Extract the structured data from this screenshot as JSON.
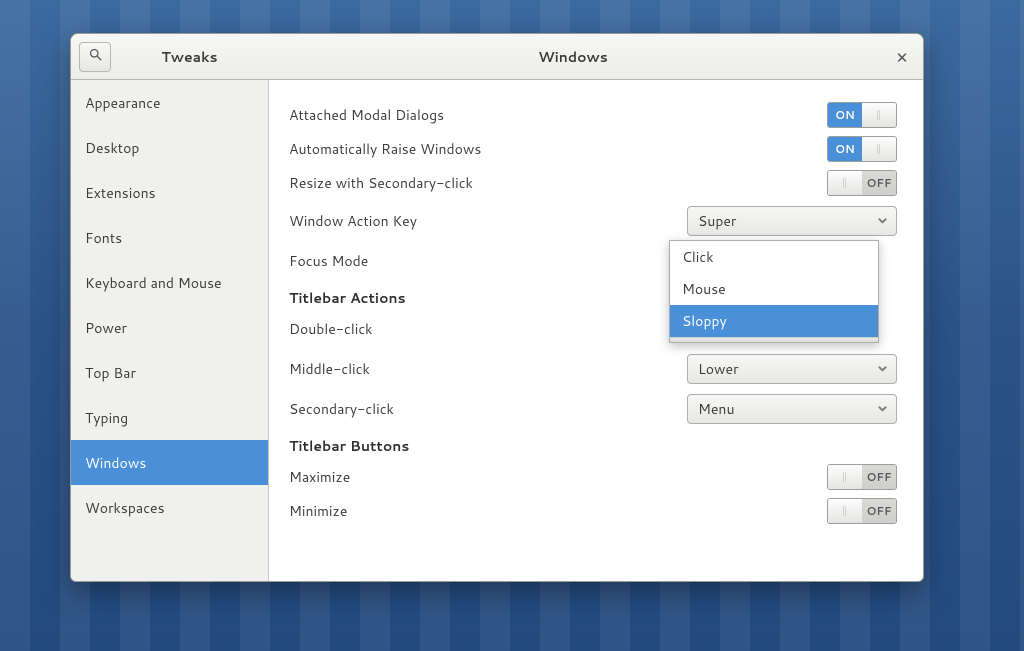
{
  "header": {
    "sidebar_title": "Tweaks",
    "main_title": "Windows"
  },
  "sidebar": {
    "items": [
      {
        "label": "Appearance"
      },
      {
        "label": "Desktop"
      },
      {
        "label": "Extensions"
      },
      {
        "label": "Fonts"
      },
      {
        "label": "Keyboard and Mouse"
      },
      {
        "label": "Power"
      },
      {
        "label": "Top Bar"
      },
      {
        "label": "Typing"
      },
      {
        "label": "Windows"
      },
      {
        "label": "Workspaces"
      }
    ],
    "selected_index": 8
  },
  "switch_labels": {
    "on": "ON",
    "off": "OFF"
  },
  "settings": {
    "attached_modal_label": "Attached Modal Dialogs",
    "attached_modal_on": true,
    "auto_raise_label": "Automatically Raise Windows",
    "auto_raise_on": true,
    "resize_secondary_label": "Resize with Secondary-click",
    "resize_secondary_on": false,
    "window_action_key_label": "Window Action Key",
    "window_action_key_value": "Super",
    "focus_mode_label": "Focus Mode",
    "focus_mode_options": [
      "Click",
      "Mouse",
      "Sloppy"
    ],
    "focus_mode_selected_index": 2,
    "titlebar_actions_heading": "Titlebar Actions",
    "double_click_label": "Double-click",
    "middle_click_label": "Middle-click",
    "middle_click_value": "Lower",
    "secondary_click_label": "Secondary-click",
    "secondary_click_value": "Menu",
    "titlebar_buttons_heading": "Titlebar Buttons",
    "maximize_label": "Maximize",
    "maximize_on": false,
    "minimize_label": "Minimize",
    "minimize_on": false
  }
}
